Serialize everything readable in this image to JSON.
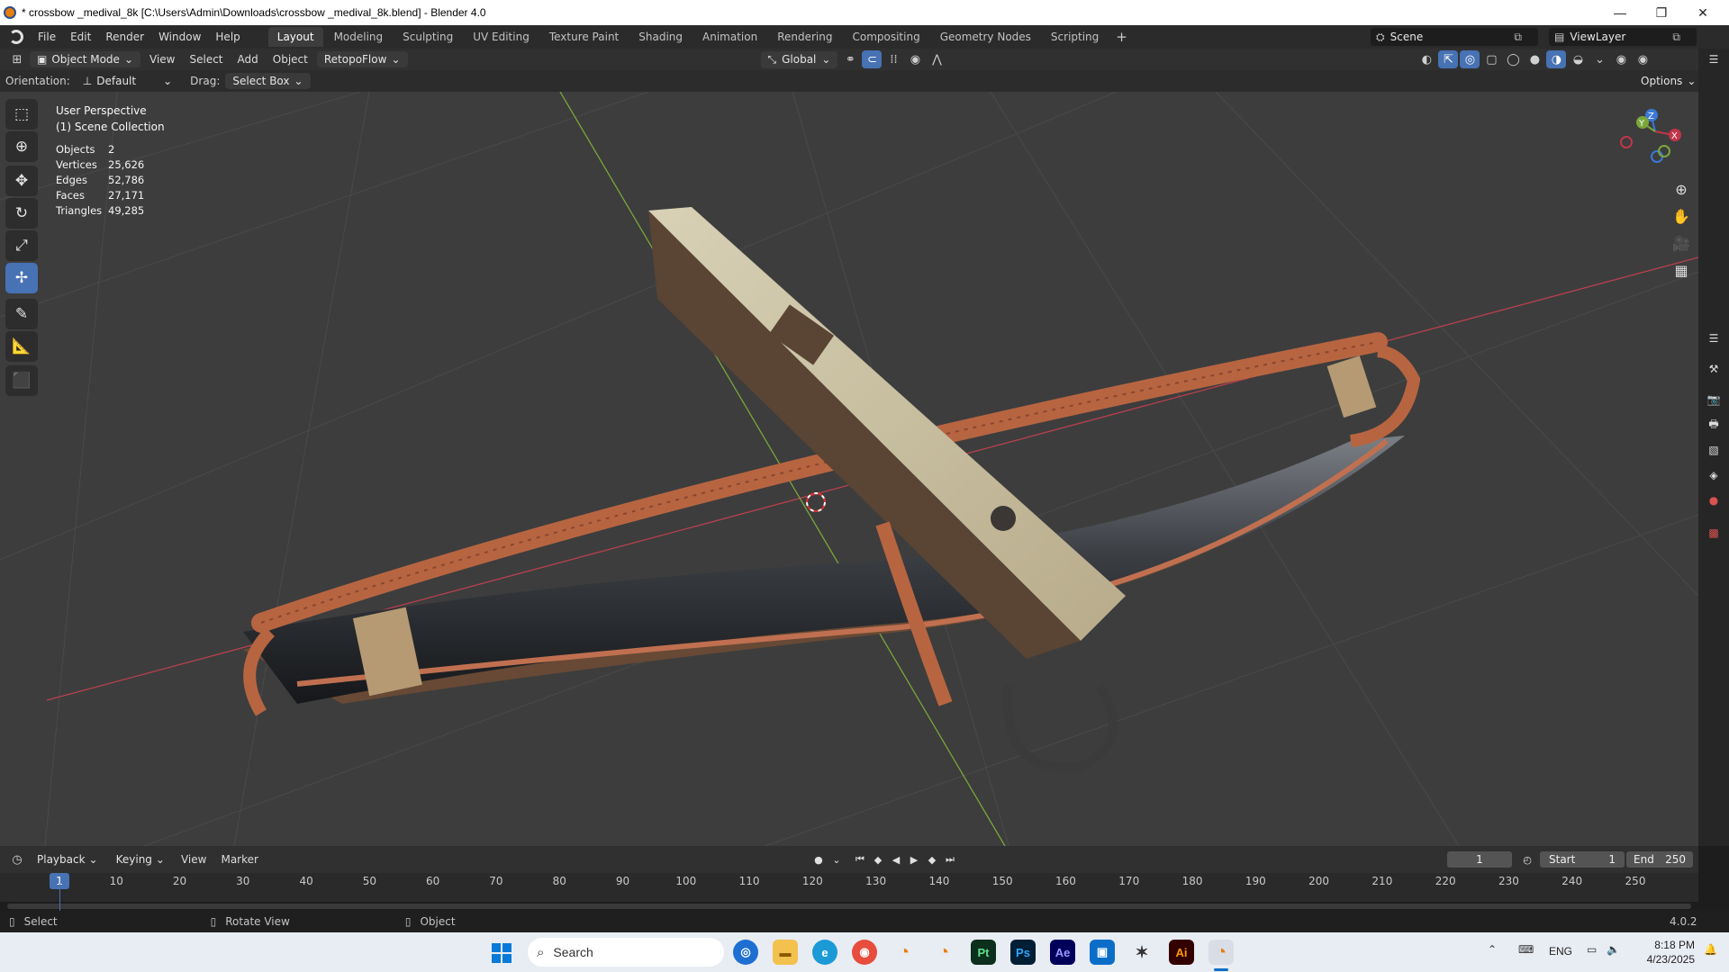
{
  "window": {
    "title": "* crossbow _medival_8k [C:\\Users\\Admin\\Downloads\\crossbow _medival_8k.blend] - Blender 4.0",
    "minimize": "—",
    "maximize": "❐",
    "close": "✕"
  },
  "menu": [
    "File",
    "Edit",
    "Render",
    "Window",
    "Help"
  ],
  "workspaces": [
    "Layout",
    "Modeling",
    "Sculpting",
    "UV Editing",
    "Texture Paint",
    "Shading",
    "Animation",
    "Rendering",
    "Compositing",
    "Geometry Nodes",
    "Scripting"
  ],
  "workspace_add": "+",
  "scene": {
    "name": "Scene",
    "view_layer": "ViewLayer"
  },
  "header": {
    "mode": "Object Mode",
    "view": "View",
    "select": "Select",
    "add": "Add",
    "object": "Object",
    "addon": "RetopoFlow",
    "transform": "Global"
  },
  "tool": {
    "orientation_label": "Orientation:",
    "orientation_value": "Default",
    "drag_label": "Drag:",
    "drag_value": "Select Box",
    "options": "Options"
  },
  "viewport": {
    "perspective": "User Perspective",
    "collection": "(1) Scene Collection",
    "stats": [
      {
        "k": "Objects",
        "v": "2"
      },
      {
        "k": "Vertices",
        "v": "25,626"
      },
      {
        "k": "Edges",
        "v": "52,786"
      },
      {
        "k": "Faces",
        "v": "27,171"
      },
      {
        "k": "Triangles",
        "v": "49,285"
      }
    ],
    "gizmo": {
      "x": "X",
      "y": "Y",
      "z": "Z"
    }
  },
  "timeline": {
    "playback": "Playback",
    "keying": "Keying",
    "view": "View",
    "marker": "Marker",
    "current": "1",
    "start_label": "Start",
    "start": "1",
    "end_label": "End",
    "end": "250",
    "ticks": [
      "1",
      "10",
      "20",
      "30",
      "40",
      "50",
      "60",
      "70",
      "80",
      "90",
      "100",
      "110",
      "120",
      "130",
      "140",
      "150",
      "160",
      "170",
      "180",
      "190",
      "200",
      "210",
      "220",
      "230",
      "240",
      "250"
    ]
  },
  "status": {
    "select": "Select",
    "rotate": "Rotate View",
    "object": "Object",
    "version": "4.0.2"
  },
  "taskbar": {
    "search": "Search",
    "lang": "ENG",
    "time": "8:18 PM",
    "date": "4/23/2025",
    "apps": [
      "Pt",
      "Ps",
      "Ae",
      "Ai"
    ]
  },
  "colors": {
    "accent": "#4772b3",
    "x_axis": "#c3354a",
    "y_axis": "#7aa63a",
    "z_axis": "#3a78d8"
  }
}
